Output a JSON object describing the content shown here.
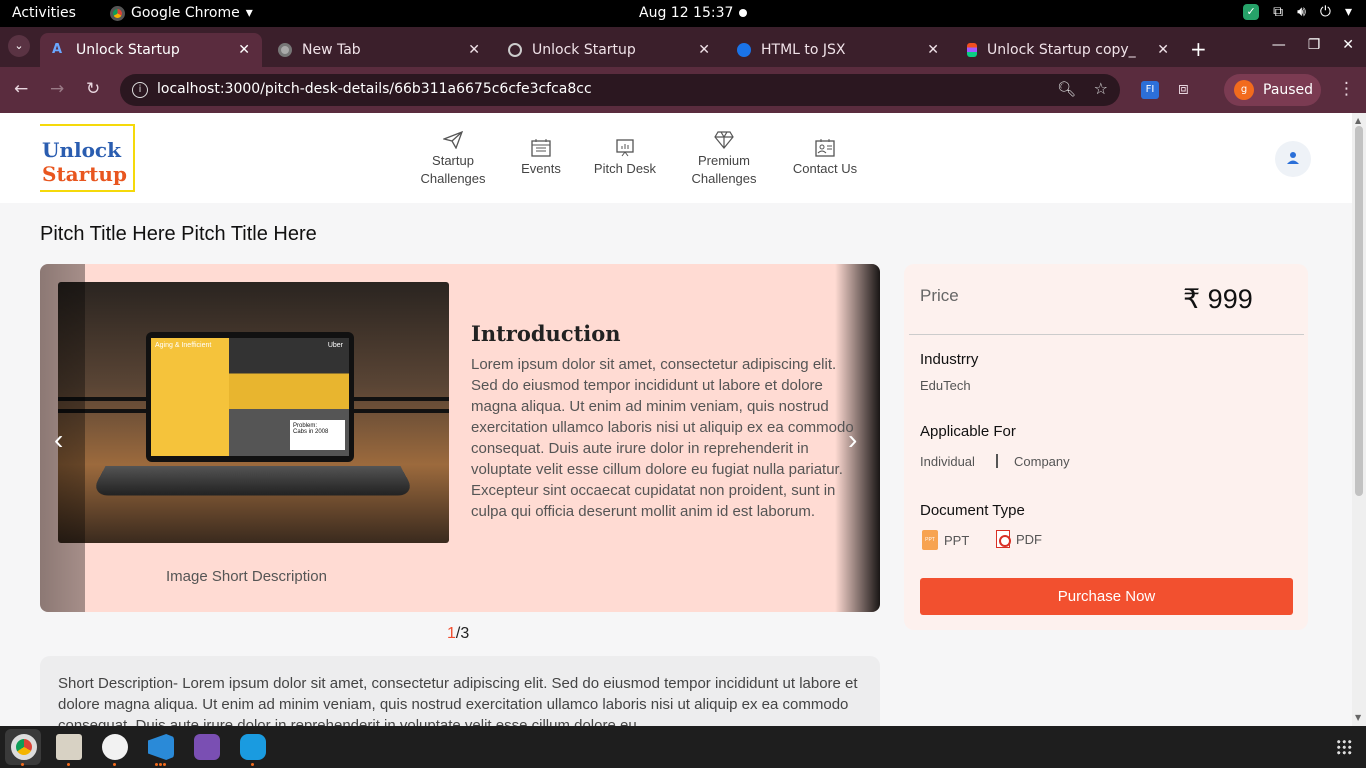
{
  "system": {
    "activities": "Activities",
    "app_name": "Google Chrome",
    "clock": "Aug 12  15:37"
  },
  "browser": {
    "tabs": [
      {
        "label": "Unlock Startup",
        "active": true,
        "icon": "unlock-startup-favicon"
      },
      {
        "label": "New Tab",
        "active": false,
        "icon": "chrome-icon"
      },
      {
        "label": "Unlock Startup",
        "active": false,
        "icon": "globe-icon"
      },
      {
        "label": "HTML to JSX",
        "active": false,
        "icon": "transform-icon"
      },
      {
        "label": "Unlock Startup copy_",
        "active": false,
        "icon": "figma-icon"
      }
    ],
    "url": "localhost:3000/pitch-desk-details/66b311a6675c6cfe3cfca8cc",
    "profile_initial": "g",
    "profile_status": "Paused",
    "extension_label": "FI"
  },
  "site": {
    "logo_line1": "Unlock",
    "logo_line2": "Startup",
    "nav": [
      {
        "label_line1": "Startup",
        "label_line2": "Challenges",
        "icon": "paper-plane-icon"
      },
      {
        "label_line1": "Events",
        "label_line2": "",
        "icon": "calendar-icon"
      },
      {
        "label_line1": "Pitch Desk",
        "label_line2": "",
        "icon": "presentation-icon"
      },
      {
        "label_line1": "Premium",
        "label_line2": "Challenges",
        "icon": "diamond-icon"
      },
      {
        "label_line1": "Contact Us",
        "label_line2": "",
        "icon": "contact-card-icon"
      }
    ]
  },
  "pitch": {
    "title": "Pitch Title Here Pitch Title Here",
    "slide": {
      "heading": "Introduction",
      "body": "Lorem ipsum dolor sit amet, consectetur adipiscing elit. Sed do eiusmod tempor incididunt ut labore et dolore magna aliqua. Ut enim ad minim veniam, quis nostrud exercitation ullamco laboris nisi ut aliquip ex ea commodo consequat. Duis aute irure dolor in reprehenderit in voluptate velit esse cillum dolore eu fugiat nulla pariatur. Excepteur sint occaecat cupidatat non proident, sunt in culpa qui officia deserunt mollit anim id est laborum.",
      "image_caption": "Image Short Description",
      "image_text": {
        "panel_title": "Aging & Inefficient",
        "brand": "Uber",
        "problem_title": "Problem:",
        "problem_sub": "Cabs in 2008"
      }
    },
    "pager_current": "1",
    "pager_total": "/3",
    "short_description": "Short Description- Lorem ipsum dolor sit amet, consectetur adipiscing elit. Sed do eiusmod tempor incididunt ut labore et dolore magna aliqua. Ut enim ad minim veniam, quis nostrud exercitation ullamco laboris nisi ut aliquip ex ea commodo consequat. Duis aute irure dolor in reprehenderit in voluptate velit esse cillum dolore eu"
  },
  "details": {
    "price_label": "Price",
    "price_value": "₹ 999",
    "industry_label": "Industrry",
    "industry_value": "EduTech",
    "applicable_label": "Applicable For",
    "applicable_values": [
      "Individual",
      "Company"
    ],
    "doc_type_label": "Document Type",
    "doc_types": [
      "PPT",
      "PDF"
    ],
    "purchase_label": "Purchase Now"
  },
  "colors": {
    "accent": "#f2502f",
    "carousel_bg": "#ffdbd3",
    "side_panel_bg": "#fdf1ee"
  },
  "dock": {
    "apps": [
      "chrome-icon",
      "files-icon",
      "mongodb-compass-icon",
      "vscode-icon",
      "github-desktop-icon",
      "skype-icon"
    ]
  }
}
